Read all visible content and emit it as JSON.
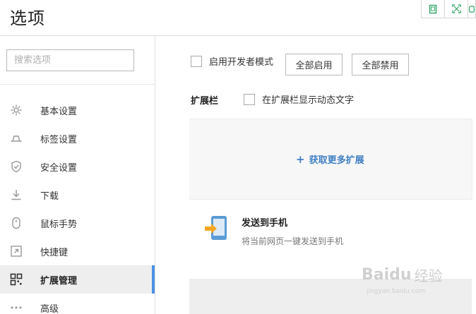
{
  "header": {
    "title": "选项",
    "window_buttons": [
      "restore-icon",
      "fullscreen-icon",
      "pin-icon"
    ]
  },
  "sidebar": {
    "search_placeholder": "搜索选项",
    "items": [
      {
        "label": "基本设置",
        "icon": "gear-icon",
        "active": false
      },
      {
        "label": "标签设置",
        "icon": "tab-icon",
        "active": false
      },
      {
        "label": "安全设置",
        "icon": "shield-check-icon",
        "active": false
      },
      {
        "label": "下载",
        "icon": "download-icon",
        "active": false
      },
      {
        "label": "鼠标手势",
        "icon": "mouse-icon",
        "active": false
      },
      {
        "label": "快捷键",
        "icon": "shortcut-icon",
        "active": false
      },
      {
        "label": "扩展管理",
        "icon": "grid-icon",
        "active": true
      },
      {
        "label": "高级",
        "icon": "more-icon",
        "active": false
      }
    ]
  },
  "main": {
    "developer_mode_label": "启用开发者模式",
    "enable_all_label": "全部启用",
    "disable_all_label": "全部禁用",
    "extension_bar_title": "扩展栏",
    "show_animated_text_label": "在扩展栏显示动态文字",
    "get_more_label": "获取更多扩展",
    "extensions": [
      {
        "name": "发送到手机",
        "description": "将当前网页一键发送到手机",
        "icon": "send-to-phone-icon"
      }
    ]
  },
  "watermark": {
    "text": "Baidu",
    "cn": "经验",
    "sub": "jingyan.baidu.com"
  },
  "colors": {
    "accent": "#4a90e2",
    "link": "#3f7fc4",
    "ext_icon_blue": "#5b9bd5",
    "ext_icon_orange": "#f5a623"
  }
}
